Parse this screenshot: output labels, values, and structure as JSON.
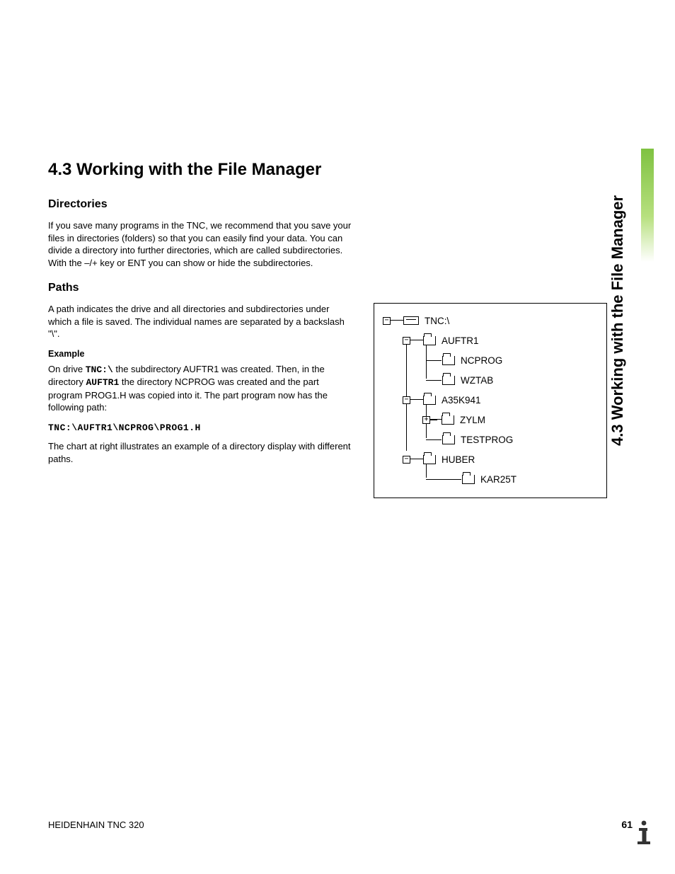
{
  "section": {
    "title": "4.3  Working with the File Manager",
    "sub1": "Directories",
    "para1": "If you save many programs in the TNC, we recommend that you save your files in directories (folders) so that you can easily find your data. You can divide a directory into further directories, which are called subdirectories. With the –/+ key or ENT you can show or hide the subdirectories.",
    "sub2": "Paths",
    "para2": "A path indicates the drive and all directories and subdirectories under which a file is saved. The individual names are separated by a backslash \"\\\".",
    "example_label": "Example",
    "para3a": "On drive ",
    "para3b": " the subdirectory AUFTR1 was created. Then, in the directory ",
    "para3c": " the directory NCPROG was created and the part program PROG1.H was copied into it. The part program now has the following path:",
    "tnc_drive": "TNC:\\",
    "auftr1": "AUFTR1",
    "path_code": "TNC:\\AUFTR1\\NCPROG\\PROG1.H",
    "para4": "The chart at right illustrates an example of a directory display with different paths."
  },
  "tree": {
    "root": "TNC:\\",
    "n1": "AUFTR1",
    "n1a": "NCPROG",
    "n1b": "WZTAB",
    "n2": "A35K941",
    "n2a": "ZYLM",
    "n2b": "TESTPROG",
    "n3": "HUBER",
    "n3a": "KAR25T"
  },
  "side_tab": "4.3 Working with the File Manager",
  "footer": {
    "left": "HEIDENHAIN TNC 320",
    "page": "61"
  }
}
